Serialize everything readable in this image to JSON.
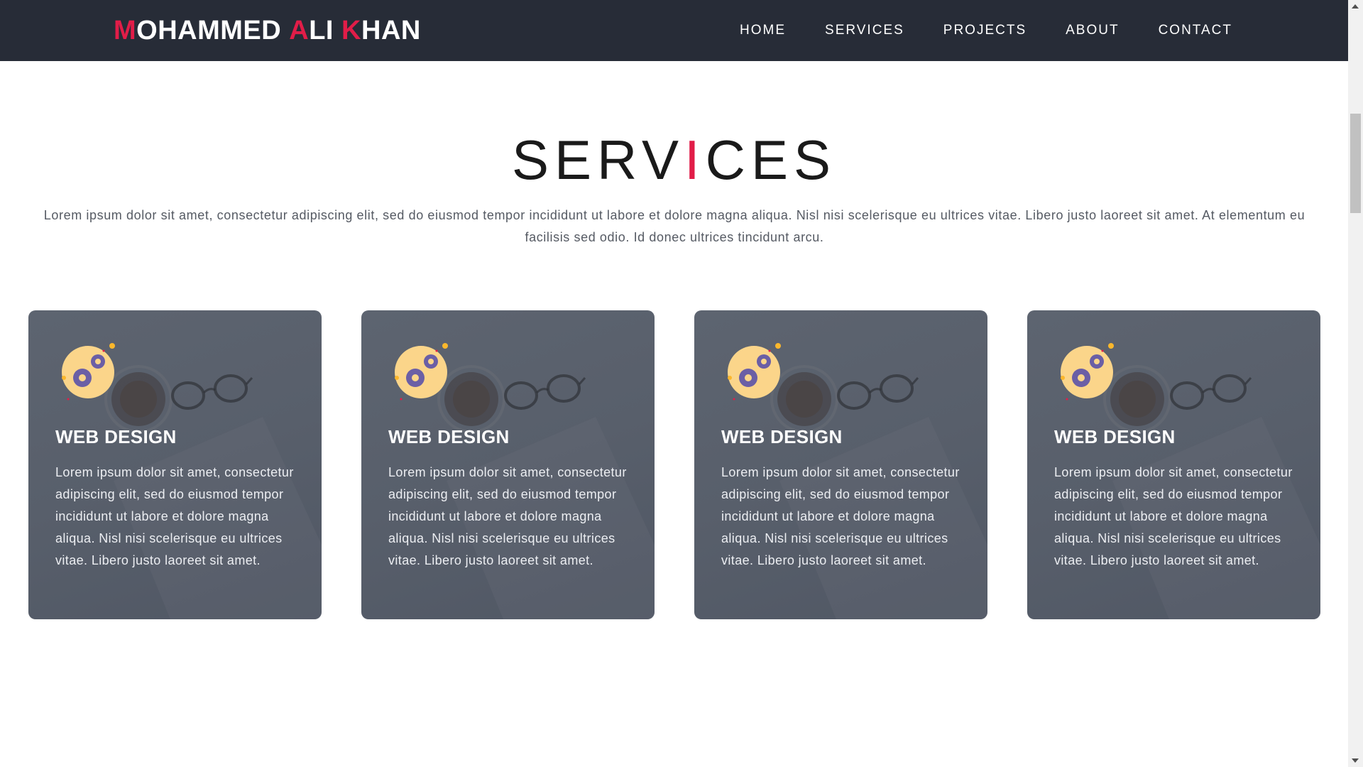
{
  "brand": {
    "name_parts": [
      {
        "text": "M",
        "accent": true
      },
      {
        "text": "OHAMMED ",
        "accent": false
      },
      {
        "text": "A",
        "accent": true
      },
      {
        "text": "LI ",
        "accent": false
      },
      {
        "text": "K",
        "accent": true
      },
      {
        "text": "HAN",
        "accent": false
      }
    ]
  },
  "nav": {
    "items": [
      "HOME",
      "SERVICES",
      "PROJECTS",
      "ABOUT",
      "CONTACT"
    ]
  },
  "services": {
    "title_left": "SERV",
    "title_bar": "I",
    "title_right": "CES",
    "description": "Lorem ipsum dolor sit amet, consectetur adipiscing elit, sed do eiusmod tempor incididunt ut labore et dolore magna aliqua. Nisl nisi scelerisque eu ultrices vitae. Libero justo laoreet sit amet. At elementum eu facilisis sed odio. Id donec ultrices tincidunt arcu.",
    "cards": [
      {
        "icon": "gears-icon",
        "title": "WEB DESIGN",
        "text": "Lorem ipsum dolor sit amet, consectetur adipiscing elit, sed do eiusmod tempor incididunt ut labore et dolore magna aliqua. Nisl nisi scelerisque eu ultrices vitae. Libero justo laoreet sit amet."
      },
      {
        "icon": "gears-icon",
        "title": "WEB DESIGN",
        "text": "Lorem ipsum dolor sit amet, consectetur adipiscing elit, sed do eiusmod tempor incididunt ut labore et dolore magna aliqua. Nisl nisi scelerisque eu ultrices vitae. Libero justo laoreet sit amet."
      },
      {
        "icon": "gears-icon",
        "title": "WEB DESIGN",
        "text": "Lorem ipsum dolor sit amet, consectetur adipiscing elit, sed do eiusmod tempor incididunt ut labore et dolore magna aliqua. Nisl nisi scelerisque eu ultrices vitae. Libero justo laoreet sit amet."
      },
      {
        "icon": "gears-icon",
        "title": "WEB DESIGN",
        "text": "Lorem ipsum dolor sit amet, consectetur adipiscing elit, sed do eiusmod tempor incididunt ut labore et dolore magna aliqua. Nisl nisi scelerisque eu ultrices vitae. Libero justo laoreet sit amet."
      }
    ]
  },
  "colors": {
    "navbar": "#272c37",
    "accent": "#e11d48",
    "card": "#5a616d"
  }
}
